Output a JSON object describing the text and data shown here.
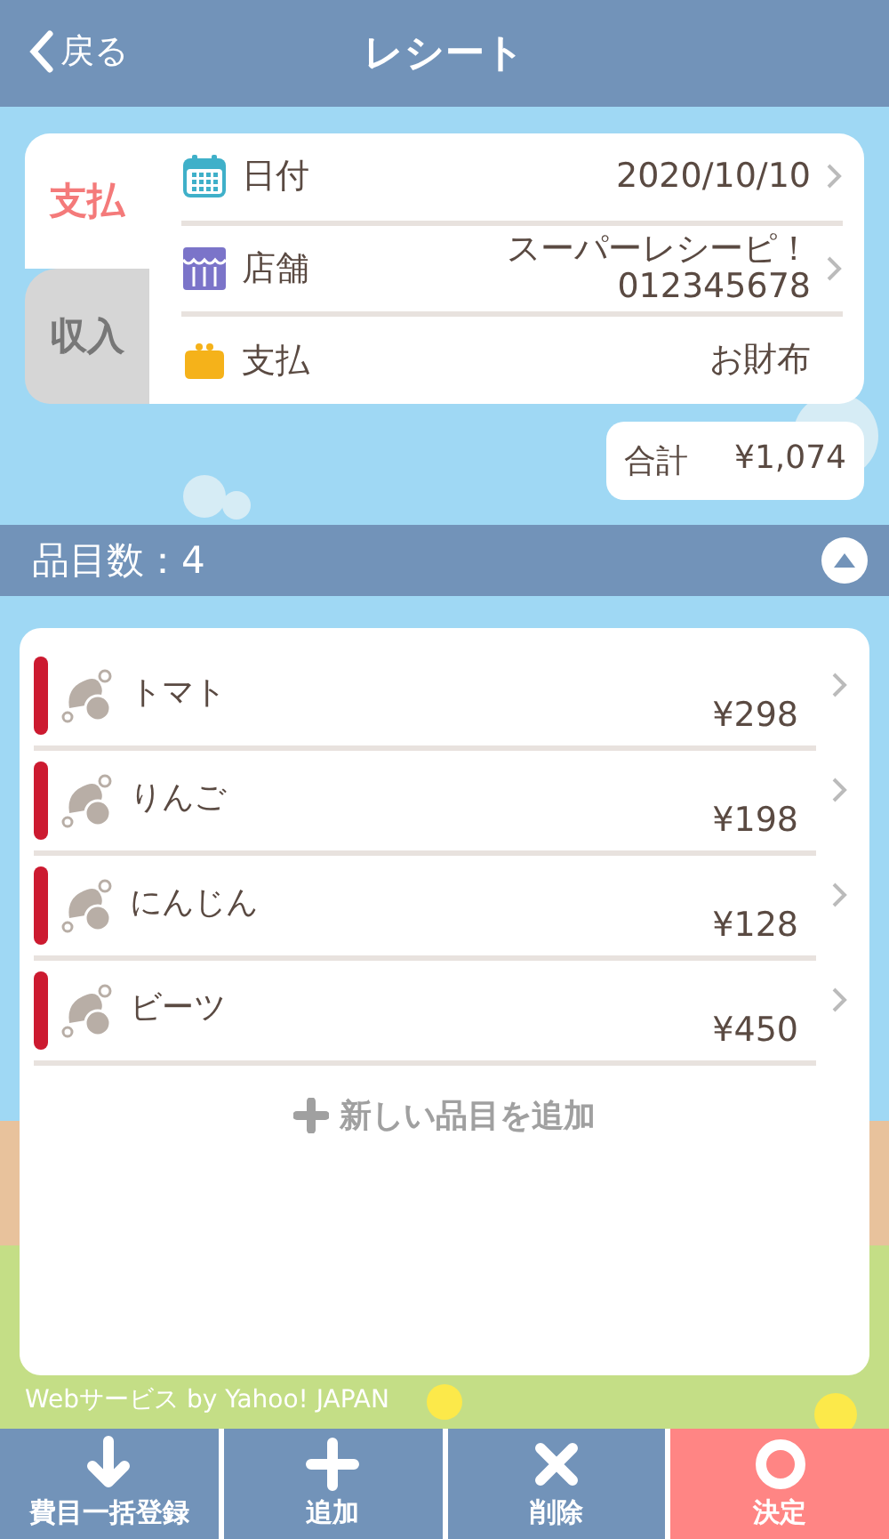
{
  "header": {
    "back": "戻る",
    "title": "レシート"
  },
  "type_tabs": [
    {
      "label": "支払",
      "selected": true
    },
    {
      "label": "収入",
      "selected": false
    }
  ],
  "fields": [
    {
      "kind": "calendar",
      "label": "日付",
      "value": "2020/10/10",
      "chevron": true
    },
    {
      "kind": "shop",
      "label": "店舗",
      "value": "スーパーレシーピ！",
      "value_2": "012345678",
      "chevron": true
    },
    {
      "kind": "wallet",
      "label": "支払",
      "value": "お財布",
      "chevron": false
    }
  ],
  "total": {
    "label": "合計",
    "value": "¥1,074"
  },
  "items_header": {
    "title": "品目数：4",
    "expanded": true
  },
  "items": [
    {
      "name": "トマト",
      "price": "¥298"
    },
    {
      "name": "りんご",
      "price": "¥198"
    },
    {
      "name": "にんじん",
      "price": "¥128"
    },
    {
      "name": "ビーツ",
      "price": "¥450"
    }
  ],
  "add_item": "新しい品目を追加",
  "credit": "Webサービス by Yahoo! JAPAN",
  "toolbar": [
    {
      "kind": "down",
      "label": "費目一括登録",
      "primary": false
    },
    {
      "kind": "plus",
      "label": "追加",
      "primary": false
    },
    {
      "kind": "cross",
      "label": "削除",
      "primary": false
    },
    {
      "kind": "circle",
      "label": "決定",
      "primary": true
    }
  ]
}
